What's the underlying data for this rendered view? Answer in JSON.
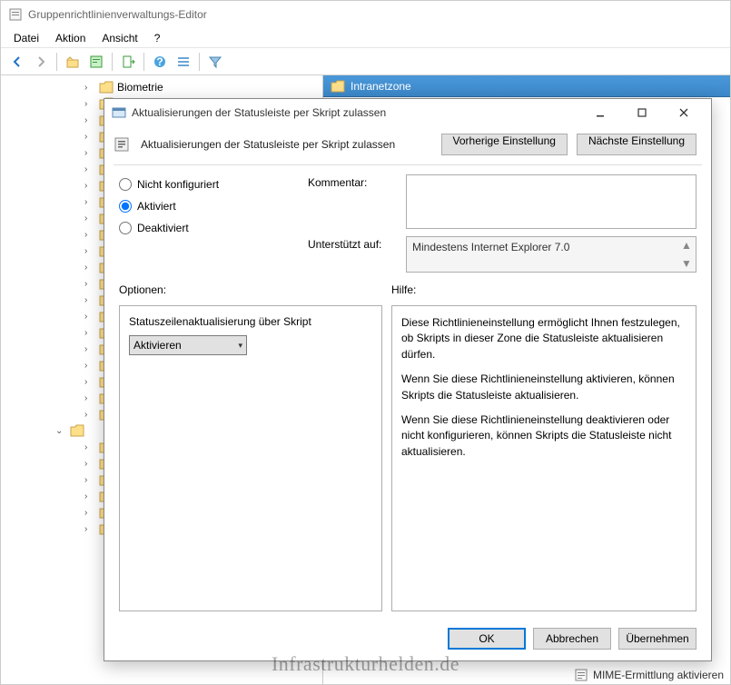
{
  "main": {
    "title": "Gruppenrichtlinienverwaltungs-Editor",
    "menu": {
      "file": "Datei",
      "action": "Aktion",
      "view": "Ansicht",
      "help": "?"
    },
    "tree": {
      "biometrie": "Biometrie"
    },
    "right_header": "Intranetzone",
    "status_item": "MIME-Ermittlung aktivieren"
  },
  "dialog": {
    "title": "Aktualisierungen der Statusleiste per Skript zulassen",
    "subtitle": "Aktualisierungen der Statusleiste per Skript zulassen",
    "prev_btn": "Vorherige Einstellung",
    "next_btn": "Nächste Einstellung",
    "radio": {
      "not_configured": "Nicht konfiguriert",
      "enabled": "Aktiviert",
      "disabled": "Deaktiviert"
    },
    "comment_label": "Kommentar:",
    "comment_value": "",
    "supported_label": "Unterstützt auf:",
    "supported_value": "Mindestens Internet Explorer 7.0",
    "options_label": "Optionen:",
    "help_label": "Hilfe:",
    "options": {
      "title": "Statuszeilenaktualisierung über Skript",
      "dropdown_value": "Aktivieren"
    },
    "help": {
      "p1": "Diese Richtlinieneinstellung ermöglicht Ihnen festzulegen, ob Skripts in dieser Zone die Statusleiste aktualisieren dürfen.",
      "p2": "Wenn Sie diese Richtlinieneinstellung aktivieren, können Skripts die Statusleiste aktualisieren.",
      "p3": "Wenn Sie diese Richtlinieneinstellung deaktivieren oder nicht konfigurieren, können Skripts die Statusleiste nicht aktualisieren."
    },
    "buttons": {
      "ok": "OK",
      "cancel": "Abbrechen",
      "apply": "Übernehmen"
    }
  },
  "watermark": "Infrastrukturhelden.de"
}
